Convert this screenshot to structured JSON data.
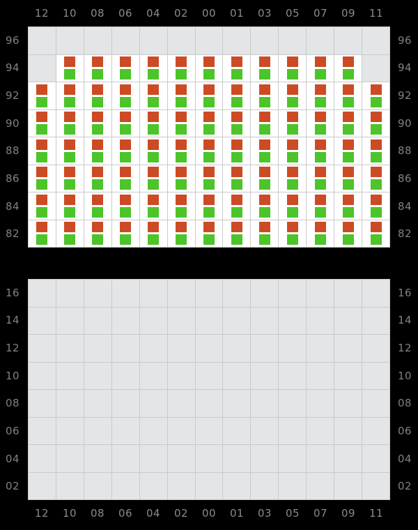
{
  "colors": {
    "background": "#000000",
    "grid_fill_empty": "#e4e5e7",
    "grid_fill_active": "#ffffff",
    "grid_line": "#c9cacd",
    "label_text": "#888b8f",
    "marker_up": "#cc4b24",
    "marker_down": "#4cc42a"
  },
  "chart_data": {
    "type": "heatmap",
    "title": "",
    "subtitle": "",
    "xlabel": "",
    "ylabel": "",
    "grid": true,
    "legend_position": "none",
    "panels": [
      {
        "name": "top-panel",
        "x_tick_labels": [
          "12",
          "10",
          "08",
          "06",
          "04",
          "02",
          "00",
          "01",
          "03",
          "05",
          "07",
          "09",
          "11"
        ],
        "y_tick_labels": [
          "96",
          "94",
          "92",
          "90",
          "88",
          "86",
          "84",
          "82"
        ],
        "y_tick_labels_right": [
          "96",
          "94",
          "92",
          "90",
          "88",
          "86",
          "84",
          "82"
        ],
        "x_axis_position": "top",
        "cells": [
          {
            "row": "96",
            "values": [
              0,
              0,
              0,
              0,
              0,
              0,
              0,
              0,
              0,
              0,
              0,
              0,
              0
            ]
          },
          {
            "row": "94",
            "values": [
              0,
              1,
              1,
              1,
              1,
              1,
              1,
              1,
              1,
              1,
              1,
              1,
              0
            ]
          },
          {
            "row": "92",
            "values": [
              1,
              1,
              1,
              1,
              1,
              1,
              1,
              1,
              1,
              1,
              1,
              1,
              1
            ]
          },
          {
            "row": "90",
            "values": [
              1,
              1,
              1,
              1,
              1,
              1,
              1,
              1,
              1,
              1,
              1,
              1,
              1
            ]
          },
          {
            "row": "88",
            "values": [
              1,
              1,
              1,
              1,
              1,
              1,
              1,
              1,
              1,
              1,
              1,
              1,
              1
            ]
          },
          {
            "row": "86",
            "values": [
              1,
              1,
              1,
              1,
              1,
              1,
              1,
              1,
              1,
              1,
              1,
              1,
              1
            ]
          },
          {
            "row": "84",
            "values": [
              1,
              1,
              1,
              1,
              1,
              1,
              1,
              1,
              1,
              1,
              1,
              1,
              1
            ]
          },
          {
            "row": "82",
            "values": [
              1,
              1,
              1,
              1,
              1,
              1,
              1,
              1,
              1,
              1,
              1,
              1,
              1
            ]
          }
        ],
        "marker": {
          "top_square": "up",
          "bottom_square": "down"
        }
      },
      {
        "name": "bottom-panel",
        "x_tick_labels": [
          "12",
          "10",
          "08",
          "06",
          "04",
          "02",
          "00",
          "01",
          "03",
          "05",
          "07",
          "09",
          "11"
        ],
        "y_tick_labels": [
          "16",
          "14",
          "12",
          "10",
          "08",
          "06",
          "04",
          "02"
        ],
        "y_tick_labels_right": [
          "16",
          "14",
          "12",
          "10",
          "08",
          "06",
          "04",
          "02"
        ],
        "x_axis_position": "bottom",
        "cells": [
          {
            "row": "16",
            "values": [
              0,
              0,
              0,
              0,
              0,
              0,
              0,
              0,
              0,
              0,
              0,
              0,
              0
            ]
          },
          {
            "row": "14",
            "values": [
              0,
              0,
              0,
              0,
              0,
              0,
              0,
              0,
              0,
              0,
              0,
              0,
              0
            ]
          },
          {
            "row": "12",
            "values": [
              0,
              0,
              0,
              0,
              0,
              0,
              0,
              0,
              0,
              0,
              0,
              0,
              0
            ]
          },
          {
            "row": "10",
            "values": [
              0,
              0,
              0,
              0,
              0,
              0,
              0,
              0,
              0,
              0,
              0,
              0,
              0
            ]
          },
          {
            "row": "08",
            "values": [
              0,
              0,
              0,
              0,
              0,
              0,
              0,
              0,
              0,
              0,
              0,
              0,
              0
            ]
          },
          {
            "row": "06",
            "values": [
              0,
              0,
              0,
              0,
              0,
              0,
              0,
              0,
              0,
              0,
              0,
              0,
              0
            ]
          },
          {
            "row": "04",
            "values": [
              0,
              0,
              0,
              0,
              0,
              0,
              0,
              0,
              0,
              0,
              0,
              0,
              0
            ]
          },
          {
            "row": "02",
            "values": [
              0,
              0,
              0,
              0,
              0,
              0,
              0,
              0,
              0,
              0,
              0,
              0,
              0
            ]
          }
        ],
        "marker": {
          "top_square": "up",
          "bottom_square": "down"
        }
      }
    ]
  }
}
